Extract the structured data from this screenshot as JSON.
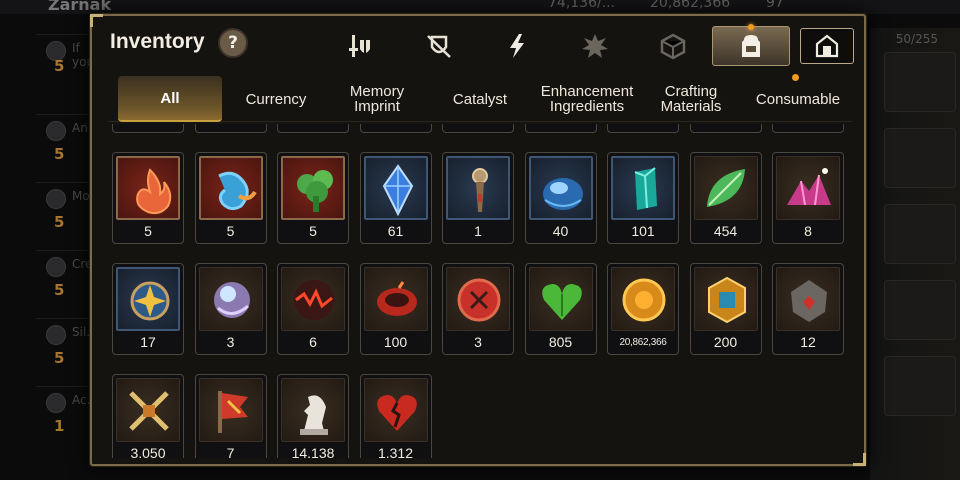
{
  "background": {
    "title": "Zarnak",
    "resources": [
      "74,136/...",
      "20,862,366",
      "97"
    ],
    "slot_count": "50/255",
    "list": [
      {
        "text": "If you...",
        "value": "5"
      },
      {
        "text": "An...",
        "value": "5"
      },
      {
        "text": "Mo...",
        "value": "5"
      },
      {
        "text": "Cre...",
        "value": "5"
      },
      {
        "text": "Sil...",
        "value": "5"
      },
      {
        "text": "Ac...",
        "value": "1"
      }
    ]
  },
  "modal": {
    "title": "Inventory",
    "help_label": "?",
    "category_icons": [
      "equipment-icon",
      "artifact-icon",
      "lightning-icon",
      "rune-icon",
      "cube-icon",
      "backpack-icon"
    ],
    "storage_icon": "storage-icon"
  },
  "tabs": [
    {
      "label": "All",
      "active": true
    },
    {
      "label": "Currency"
    },
    {
      "label": "Memory Imprint"
    },
    {
      "label": "Catalyst"
    },
    {
      "label": "Enhancement Ingredients"
    },
    {
      "label": "Crafting Materials"
    },
    {
      "label": "Consumable"
    }
  ],
  "items": [
    {
      "icon": "flame-rune-icon",
      "qty": "5",
      "frame": "red"
    },
    {
      "icon": "water-rune-icon",
      "qty": "5",
      "frame": "red"
    },
    {
      "icon": "tree-rune-icon",
      "qty": "5",
      "frame": "red"
    },
    {
      "icon": "blue-crystal-icon",
      "qty": "61",
      "frame": "blue"
    },
    {
      "icon": "key-charm-icon",
      "qty": "1",
      "frame": "blue"
    },
    {
      "icon": "water-orb-icon",
      "qty": "40",
      "frame": "blue"
    },
    {
      "icon": "teal-crystal-icon",
      "qty": "101",
      "frame": "blue"
    },
    {
      "icon": "leaf-icon",
      "qty": "454",
      "frame": "brown"
    },
    {
      "icon": "pink-gem-pile-icon",
      "qty": "8",
      "frame": "brown"
    },
    {
      "icon": "star-token-icon",
      "qty": "17",
      "frame": "blue"
    },
    {
      "icon": "spirit-orb-icon",
      "qty": "3",
      "frame": "brown"
    },
    {
      "icon": "dark-sphere-icon",
      "qty": "6",
      "frame": "brown"
    },
    {
      "icon": "red-ring-icon",
      "qty": "100",
      "frame": "brown"
    },
    {
      "icon": "red-badge-icon",
      "qty": "3",
      "frame": "brown"
    },
    {
      "icon": "green-heart-icon",
      "qty": "805",
      "frame": "brown"
    },
    {
      "icon": "gold-coin-icon",
      "qty": "20,862,366",
      "frame": "brown"
    },
    {
      "icon": "hex-emblem-icon",
      "qty": "200",
      "frame": "brown"
    },
    {
      "icon": "stone-heart-icon",
      "qty": "12",
      "frame": "brown"
    },
    {
      "icon": "crossed-swords-icon",
      "qty": "3,050",
      "frame": "brown"
    },
    {
      "icon": "banner-icon",
      "qty": "7",
      "frame": "brown"
    },
    {
      "icon": "knight-token-icon",
      "qty": "14,138",
      "frame": "brown"
    },
    {
      "icon": "broken-heart-icon",
      "qty": "1,312",
      "frame": "brown"
    }
  ],
  "colors": {
    "accent": "#f09a20",
    "frame_gold": "#7a6a4a",
    "panel": "#15130f"
  }
}
